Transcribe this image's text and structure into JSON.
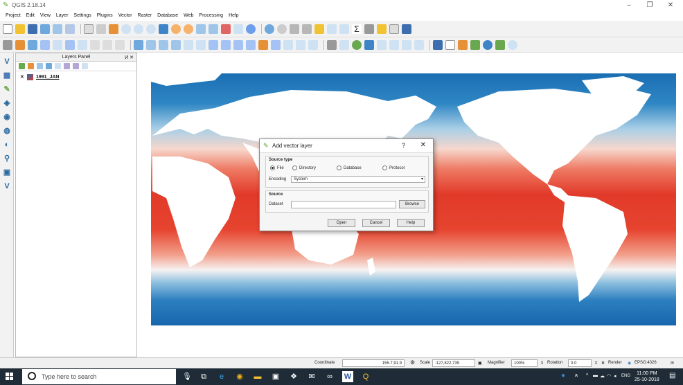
{
  "window": {
    "title": "QGIS 2.18.14",
    "minimize": "–",
    "maximize": "❐",
    "close": "✕"
  },
  "menu": [
    "Project",
    "Edit",
    "View",
    "Layer",
    "Settings",
    "Plugins",
    "Vector",
    "Raster",
    "Database",
    "Web",
    "Processing",
    "Help"
  ],
  "layers_panel": {
    "title": "Layers Panel",
    "header_buttons": "И ✕",
    "layer": {
      "checkbox": "✕",
      "name": "1991_JAN"
    }
  },
  "dialog": {
    "title": "Add vector layer",
    "help": "?",
    "close": "✕",
    "source_type_label": "Source type",
    "radios": [
      "File",
      "Directory",
      "Database",
      "Protocol"
    ],
    "selected_radio": "File",
    "encoding_label": "Encoding",
    "encoding_value": "System",
    "source_label": "Source",
    "dataset_label": "Dataset",
    "dataset_value": "",
    "browse": "Browse",
    "open": "Open",
    "cancel": "Cancel",
    "help_btn": "Help"
  },
  "statusbar": {
    "coordinate_label": "Coordinate",
    "coordinate_value": "155.7,91.9",
    "scale_label": "Scale",
    "scale_value": ":127,822,739",
    "magnifier_label": "Magnifier",
    "magnifier_value": "100%",
    "rotation_label": "Rotation",
    "rotation_value": "0.0",
    "render_label": "Render",
    "crs": "EPSG:4326"
  },
  "taskbar": {
    "search_placeholder": "Type here to search",
    "language": "ENG",
    "time": "11:00 PM",
    "date": "25-10-2018"
  },
  "colors": {
    "ocean_warm": "#e23a2a",
    "ocean_cold": "#1a6fb3",
    "ocean_mid": "#f4f4f4",
    "taskbar": "#1f2b36",
    "qgis_green": "#5aa02c"
  }
}
